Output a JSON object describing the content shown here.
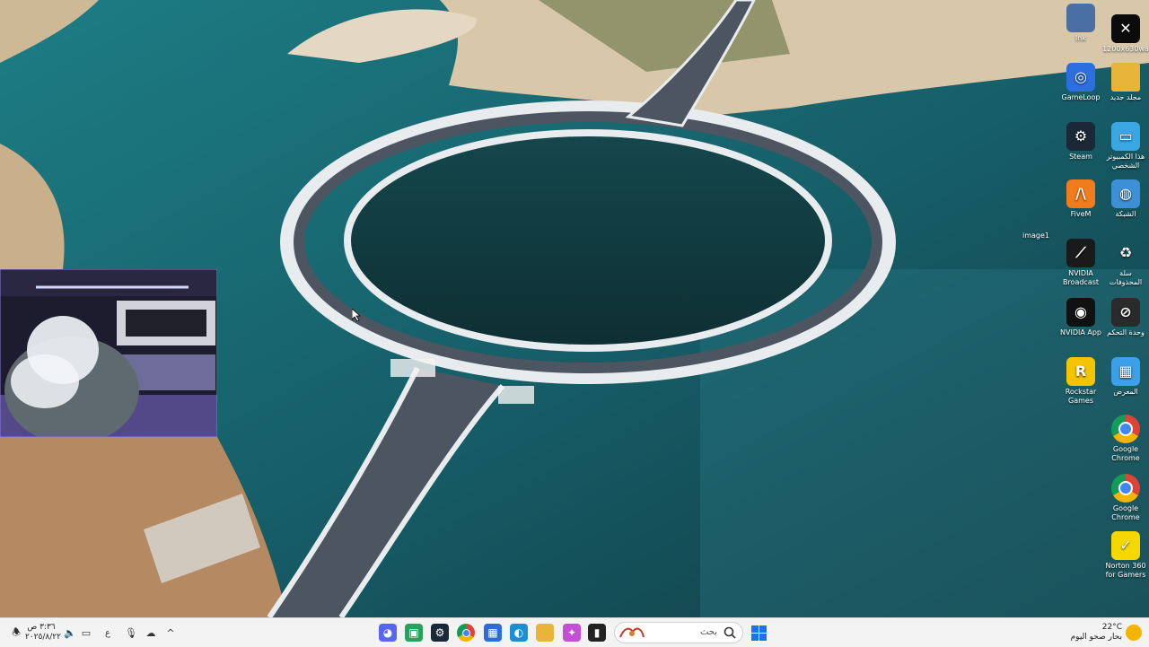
{
  "desktop": {
    "icons": [
      {
        "id": "lnk",
        "label": "lnk",
        "color": "#4a6fa5",
        "glyph": "",
        "icon": "game-shortcut-icon"
      },
      {
        "id": "screenshot",
        "label": "1200x630wa",
        "color": "#0b0b0b",
        "glyph": "✕",
        "icon": "image-file-icon"
      },
      {
        "id": "gameloop",
        "label": "GameLoop",
        "color": "#2d6fe0",
        "glyph": "◎",
        "icon": "gameloop-icon"
      },
      {
        "id": "folder",
        "label": "مجلد جديد",
        "color": "#e9b43a",
        "glyph": "",
        "icon": "folder-icon"
      },
      {
        "id": "steam",
        "label": "Steam",
        "color": "#1b2838",
        "glyph": "⚙",
        "icon": "steam-icon"
      },
      {
        "id": "this-pc",
        "label": "هذا الكمبيوتر الشخصي",
        "color": "#3aa7e0",
        "glyph": "▭",
        "icon": "computer-icon"
      },
      {
        "id": "image1",
        "label": "image1",
        "color": "transparent",
        "glyph": "",
        "icon": "image-file-icon"
      },
      {
        "id": "fivem",
        "label": "FiveM",
        "color": "#f07c1b",
        "glyph": "/\\",
        "icon": "fivem-icon"
      },
      {
        "id": "network",
        "label": "الشبكة",
        "color": "#3d8fd6",
        "glyph": "◍",
        "icon": "network-icon"
      },
      {
        "id": "nv-broadcast",
        "label": "NVIDIA Broadcast",
        "color": "#1a1a1a",
        "glyph": "⟋",
        "icon": "nvidia-broadcast-icon"
      },
      {
        "id": "recycle",
        "label": "سلة المحذوفات",
        "color": "transparent",
        "glyph": "♻",
        "icon": "recycle-bin-icon"
      },
      {
        "id": "nv-app",
        "label": "NVIDIA App",
        "color": "#111",
        "glyph": "◉",
        "icon": "nvidia-app-icon"
      },
      {
        "id": "control",
        "label": "وحدة التحكم",
        "color": "#2a2a2a",
        "glyph": "⊘",
        "icon": "control-panel-icon"
      },
      {
        "id": "rockstar",
        "label": "Rockstar Games",
        "color": "#f4c400",
        "glyph": "R",
        "icon": "rockstar-icon"
      },
      {
        "id": "gallery",
        "label": "المعرض",
        "color": "#3aa0e8",
        "glyph": "▦",
        "icon": "gallery-icon"
      },
      {
        "id": "chrome-1",
        "label": "Google Chrome",
        "color": "transparent",
        "glyph": "",
        "icon": "chrome-icon"
      },
      {
        "id": "chrome-2",
        "label": "Google Chrome",
        "color": "transparent",
        "glyph": "",
        "icon": "chrome-icon"
      },
      {
        "id": "norton",
        "label": "Norton 360 for Gamers",
        "color": "#f5d800",
        "glyph": "✓",
        "icon": "norton-icon"
      }
    ]
  },
  "taskbar": {
    "search_placeholder": "بحث",
    "weather": {
      "temp": "22°C",
      "desc": "بحار صحو اليوم"
    },
    "clock": {
      "time": "٣:٣٦ ص",
      "date": "٢٠٢٥/٨/٢٢"
    },
    "language": "ع",
    "apps": [
      {
        "name": "start-button",
        "icon": "windows-logo-icon",
        "color": "#1a73e8",
        "glyph": "⊞"
      },
      {
        "name": "taskbar-discord",
        "icon": "discord-icon",
        "color": "#5865f2",
        "glyph": "◕"
      },
      {
        "name": "taskbar-whatsapp",
        "icon": "chat-app-icon",
        "color": "#25a35a",
        "glyph": "▣"
      },
      {
        "name": "taskbar-steam",
        "icon": "steam-icon",
        "color": "#1b2838",
        "glyph": "⚙"
      },
      {
        "name": "taskbar-chrome",
        "icon": "chrome-icon",
        "color": "transparent",
        "glyph": ""
      },
      {
        "name": "taskbar-store",
        "icon": "store-icon",
        "color": "#2b6cd6",
        "glyph": "▦"
      },
      {
        "name": "taskbar-edge",
        "icon": "edge-icon",
        "color": "#1b8fd6",
        "glyph": "◐"
      },
      {
        "name": "taskbar-explorer",
        "icon": "folder-icon",
        "color": "#e9b43a",
        "glyph": ""
      },
      {
        "name": "taskbar-copilot",
        "icon": "copilot-icon",
        "color": "#c44fd6",
        "glyph": "✦"
      },
      {
        "name": "taskbar-app-black",
        "icon": "app-icon",
        "color": "#222",
        "glyph": "▮"
      }
    ]
  }
}
